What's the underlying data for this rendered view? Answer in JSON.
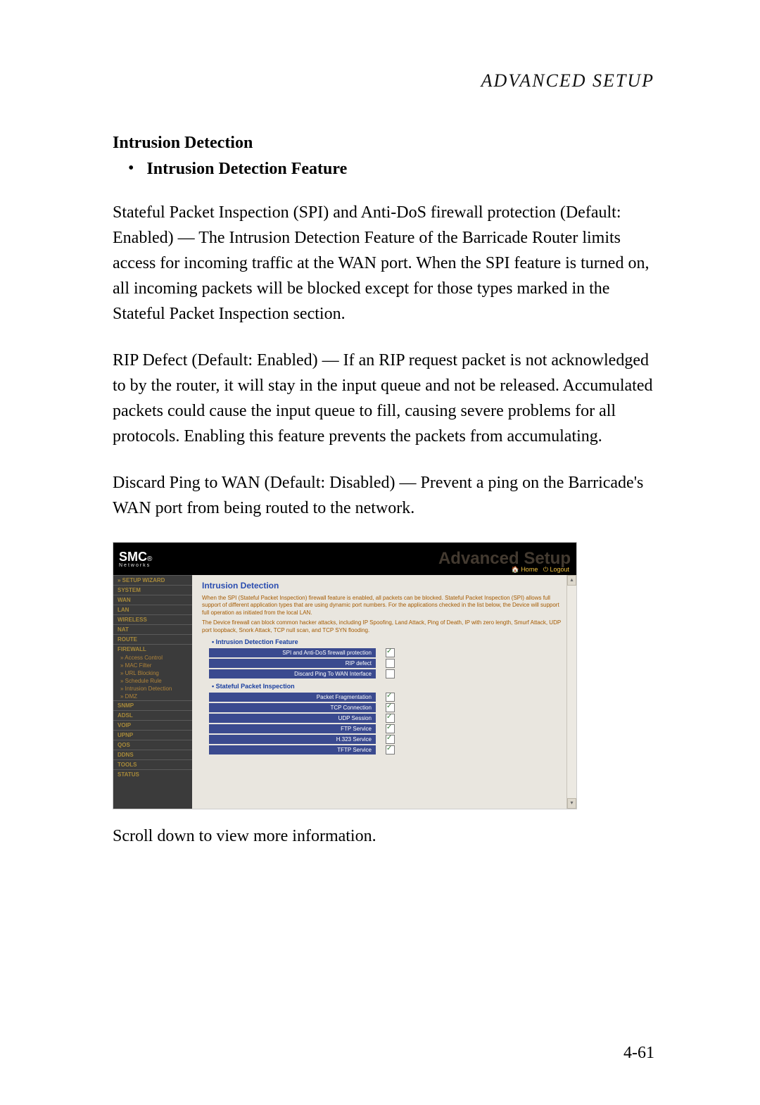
{
  "header": "ADVANCED SETUP",
  "section_title": "Intrusion Detection",
  "bullet1": "Intrusion Detection Feature",
  "para1": "Stateful Packet Inspection (SPI) and Anti-DoS firewall protection (Default: Enabled) — The Intrusion Detection Feature of the Barricade Router limits access for incoming traffic at the WAN port. When the SPI feature is turned on, all incoming packets will be blocked except for those types marked in the Stateful Packet Inspection section.",
  "para2": "RIP Defect (Default: Enabled) — If an RIP request packet is not acknowledged to by the router, it will stay in the input queue and not be released. Accumulated packets could cause the input queue to fill, causing severe problems for all protocols. Enabling this feature prevents the packets from accumulating.",
  "para3": "Discard Ping to WAN (Default: Disabled) — Prevent a ping on the Barricade's WAN port from being routed to the network.",
  "scroll_note": "Scroll down to view more information.",
  "page_number": "4-61",
  "screenshot": {
    "logo": "SMC",
    "logo_sub": "Networks",
    "brand": "Advanced Setup",
    "toplinks": {
      "home": "Home",
      "logout": "Logout"
    },
    "sidebar": [
      {
        "label": "» SETUP WIZARD",
        "type": "item"
      },
      {
        "label": "SYSTEM",
        "type": "item"
      },
      {
        "label": "WAN",
        "type": "item"
      },
      {
        "label": "LAN",
        "type": "item"
      },
      {
        "label": "WIRELESS",
        "type": "item"
      },
      {
        "label": "NAT",
        "type": "item"
      },
      {
        "label": "ROUTE",
        "type": "item"
      },
      {
        "label": "FIREWALL",
        "type": "item"
      },
      {
        "label": "» Access Control",
        "type": "sub"
      },
      {
        "label": "» MAC Filter",
        "type": "sub"
      },
      {
        "label": "» URL Blocking",
        "type": "sub"
      },
      {
        "label": "» Schedule Rule",
        "type": "sub"
      },
      {
        "label": "» Intrusion Detection",
        "type": "sub"
      },
      {
        "label": "» DMZ",
        "type": "sub"
      },
      {
        "label": "SNMP",
        "type": "item"
      },
      {
        "label": "ADSL",
        "type": "item"
      },
      {
        "label": "VoIP",
        "type": "item"
      },
      {
        "label": "UPnP",
        "type": "item"
      },
      {
        "label": "QoS",
        "type": "item"
      },
      {
        "label": "DDNS",
        "type": "item"
      },
      {
        "label": "TOOLS",
        "type": "item"
      },
      {
        "label": "STATUS",
        "type": "item"
      }
    ],
    "main": {
      "title": "Intrusion Detection",
      "desc1": "When the SPI (Stateful Packet Inspection) firewall feature is enabled, all packets can be blocked. Stateful Packet Inspection (SPI) allows full support of different application types that are using dynamic port numbers. For the applications checked in the list below, the Device will support full operation as initiated from the local LAN.",
      "desc2": "The Device firewall can block common hacker attacks, including IP Spoofing, Land Attack, Ping of Death, IP with zero length, Smurf Attack, UDP port loopback, Snork Attack, TCP null scan, and TCP SYN flooding.",
      "sub1": "• Intrusion Detection Feature",
      "rows_idf": [
        {
          "label": "SPI and Anti-DoS firewall protection",
          "checked": true
        },
        {
          "label": "RIP defect",
          "checked": false
        },
        {
          "label": "Discard Ping To WAN Interface",
          "checked": false
        }
      ],
      "sub2": "• Stateful Packet Inspection",
      "rows_spi": [
        {
          "label": "Packet Fragmentation",
          "checked": true
        },
        {
          "label": "TCP Connection",
          "checked": true
        },
        {
          "label": "UDP Session",
          "checked": true
        },
        {
          "label": "FTP Service",
          "checked": true
        },
        {
          "label": "H.323 Service",
          "checked": true
        },
        {
          "label": "TFTP Service",
          "checked": true
        }
      ]
    }
  }
}
